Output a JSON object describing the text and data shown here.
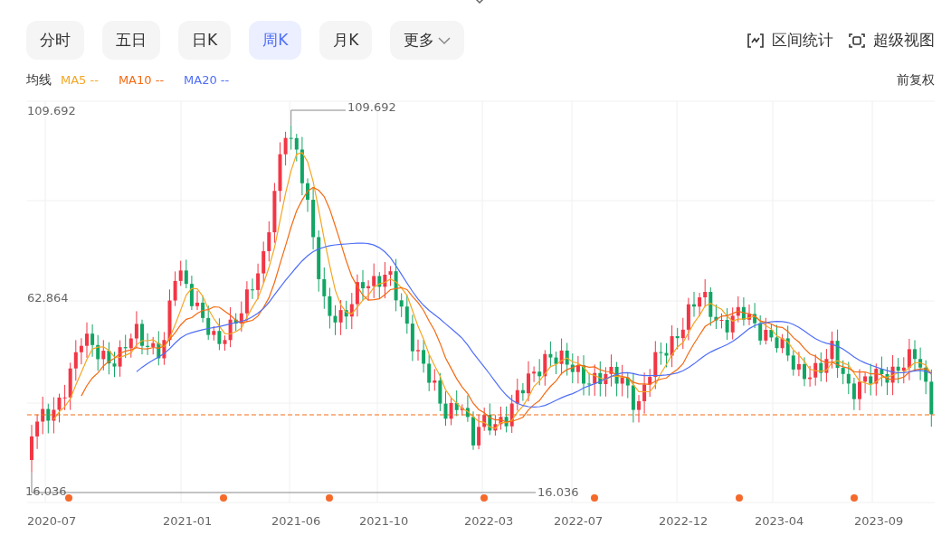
{
  "periods": [
    {
      "label": "分时",
      "selected": false,
      "kind": "period"
    },
    {
      "label": "五日",
      "selected": false,
      "kind": "period"
    },
    {
      "label": "日K",
      "selected": false,
      "kind": "period"
    },
    {
      "label": "周K",
      "selected": true,
      "kind": "period"
    },
    {
      "label": "月K",
      "selected": false,
      "kind": "period"
    },
    {
      "label": "更多",
      "selected": false,
      "kind": "menu"
    }
  ],
  "tools": [
    {
      "label": "区间统计",
      "kind": "range"
    },
    {
      "label": "超级视图",
      "kind": "fullscreen"
    }
  ],
  "ma_legend": {
    "title": "均线",
    "lines": [
      {
        "label": "MA5 --",
        "color": "#f5a623"
      },
      {
        "label": "MA10 --",
        "color": "#f56a12"
      },
      {
        "label": "MA20 --",
        "color": "#4f6ef7"
      }
    ]
  },
  "adjust": "前复权",
  "chart": {
    "y_labels": [
      "109.692",
      "62.864",
      "16.036"
    ],
    "high_label": "109.692",
    "low_label": "16.036",
    "x_labels": [
      "2020-07",
      "2021-01",
      "2021-06",
      "2021-10",
      "2022-03",
      "2022-07",
      "2022-12",
      "2023-04",
      "2023-09"
    ]
  }
}
